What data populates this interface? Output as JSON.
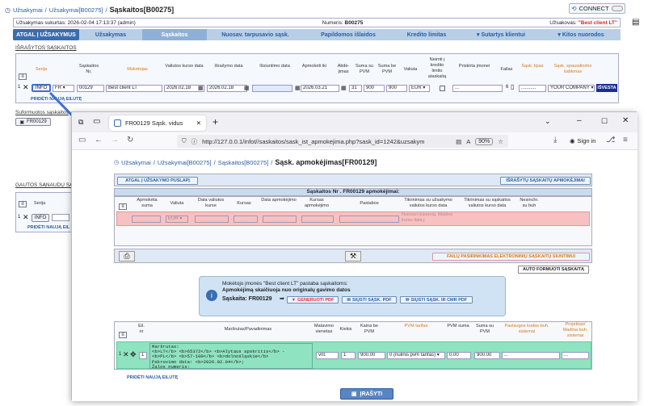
{
  "bg": {
    "crumbs": [
      "Užsakymai",
      "/",
      "Užsakymai[B00275]",
      "/"
    ],
    "title": "Sąskaitos[B00275]",
    "connect": "CONNECT",
    "info_left": "Užsakymas sukurtas: 2026-02-04 17:13:37 (admin)",
    "numeris_label": "Numeris:",
    "numeris_value": "B00275",
    "uzsakovas_label": "Užsakovas:",
    "uzsakovas_value": "\"Best client LT\"",
    "tabs": [
      "ATGAL Į UŽSAKYMUS",
      "Užsakymas",
      "Sąskaitos",
      "Nuosav. tarpusavio sąsk.",
      "Papildomos išlaidos",
      "Kredito limitas",
      "Sutartys klientui",
      "Kitos nuorodos"
    ],
    "sect1": "IŠRAŠYTOS SĄSKAITOS",
    "headers": [
      "Serija",
      "Sąskaitos Nr.",
      "Mokėtojas",
      "Valiutos kurso data",
      "Išrašymo data",
      "Išsiuntimo data",
      "Apmokėti iki",
      "Atidė-jimas",
      "Suma su PVM",
      "Suma be PVM",
      "Valiuta",
      "Neimti į kredito limito ataskaitą",
      "Priskirta įmonei",
      "Failas",
      "Sąsk. tipas",
      "Sąsk. spausdinimo šablonas"
    ],
    "row": {
      "num": "1",
      "info": "INFO",
      "serija": "FR",
      "nr": "00129",
      "moketojas": "Best client LT",
      "vkd": "2026.02.18",
      "israsymo": "2026.02.18",
      "issiuntimo": "",
      "apmoketi": "2026.03.21",
      "atidejimas": "31",
      "suma_pvm": "900",
      "suma_be": "900",
      "valiuta": "EUR",
      "imone": "...",
      "failas": "6",
      "tipas": "...........",
      "sablonas": "YOUR COMPANY",
      "issue": "IŠVESTA"
    },
    "add_row": "PRIDĖTI NAUJĄ EILUTĘ",
    "sect2": "Suformuotos sąskaitos",
    "chip": "FR00129",
    "sect3": "GAUTOS SĄNAUDŲ SĄSK",
    "serija_h": "Serija",
    "row2_num": "1",
    "row2_info": "INFO",
    "add_row2": "PRIDĖTI NAUJĄ EIL"
  },
  "browser": {
    "tab_title": "FR00129 Sąsk. vidus",
    "url": "http://127.0.0.1/infot//saskaitos/sask_ist_apmokejima.php?sask_id=1242&uzsakym",
    "zoom": "90%",
    "signin": "Sign in"
  },
  "inner": {
    "crumbs": [
      "Užsakymai",
      "/",
      "Užsakymai[B00275]",
      "/",
      "Sąskaitos[B00275]",
      "/"
    ],
    "title": "Sąsk. apmokėjimas[FR00129]",
    "back_btn": "ATGAL Į UŽSAKYMO PUSLAPĮ",
    "list_btn": "IŠRAŠYTŲ SĄSKAITŲ APMOKĖJIMAI",
    "pay_head": "Sąskaitos Nr . FR00129 apmokėjimai:",
    "pay_cols": [
      "Apmokėta suma",
      "Valiuta",
      "Data valiutos kurse",
      "Kursas",
      "Data apmokėjimo",
      "Kursas apmokėjimo",
      "Pastabos",
      "Tikrinimas su užsakymo valiutos kurso data",
      "Tikrinimas su sąskaitos valiutos kurso data",
      "Nesinchr. su buh"
    ],
    "pay_row": {
      "valiuta": "EUR",
      "note": "Nuosavi įsipareig. išlaidos kurso data j"
    },
    "efile_btn": "FAILŲ PASIRINKIMAS ELEKTRONINIŲ SĄSKAITŲ SIUNTIMUI",
    "auto_btn": "AUTO FORMUOTI SĄSKAITĄ",
    "info_line1": "Mokėtojo įmonės \"Best client LT\" pastaba sąskaitoms:",
    "info_line2": "Apmokėjimą skaičiuoja nuo originalų gavimo datos",
    "sask_label": "Sąskaita: FR00129",
    "gen_pdf": "GENERUOTI PDF",
    "send_pdf": "SIŲSTI SĄSK. PDF",
    "send_cmr": "SIŲSTI SĄSK. IR CMR PDF",
    "line_cols": [
      "Eil. nr",
      "Maršrutas/Pavadinimas",
      "Matavimo vienetas",
      "Kiekis",
      "Kaina be PVM",
      "PVM tarifas",
      "PVM suma",
      "Suma su PVM",
      "Paslaugos kodas buh. sistemai",
      "Projektas/ Madina buh. sistemai"
    ],
    "line_row": {
      "num": "1",
      "eil": "1",
      "route": "Maršrutas:\n<b>LT</b> <b>65372</b> <b>Alytaus apskritis</b> -\n<b>PL</b> <b>57-100</b> <b>dolnośląskie</b>\nPakrovimo data: <b>2026.02.04</b>;\nŽalos numeris:",
      "vnt": "vnt.",
      "kiekis": "1",
      "kaina": "900.00",
      "pvm": "0 (nulinis pvm tarifas)",
      "pvm_suma": "0.00",
      "suma": "900.00",
      "kodas": "...",
      "projektas": "..."
    },
    "add_line": "PRIDĖTI NAUJĄ EILUTĘ",
    "save": "ĮRAŠYTI"
  },
  "colors": {
    "accent": "#3a6db0",
    "tabbar": "#b9cfe6",
    "pink": "#f7c1c1",
    "green": "#8fe3c0",
    "infobox": "#cfe3f4",
    "arrow": "#3d6fd6"
  }
}
